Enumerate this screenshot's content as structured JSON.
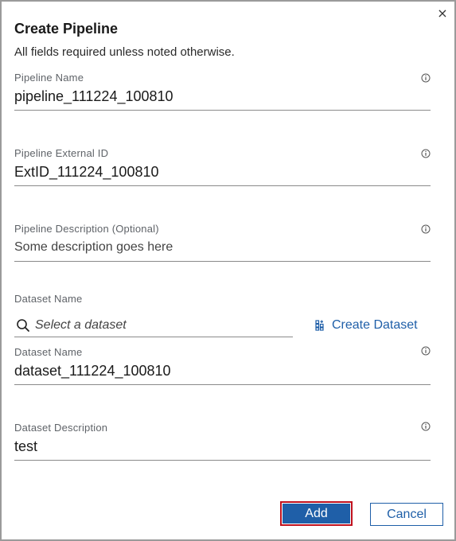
{
  "dialog": {
    "title": "Create Pipeline",
    "subtitle": "All fields required unless noted otherwise.",
    "close_glyph": "×"
  },
  "fields": {
    "pipeline_name": {
      "label": "Pipeline Name",
      "value": "pipeline_111224_100810"
    },
    "pipeline_external_id": {
      "label": "Pipeline External ID",
      "value": "ExtID_111224_100810"
    },
    "pipeline_description": {
      "label": "Pipeline Description (Optional)",
      "value": "Some description goes here"
    },
    "dataset_section_label": "Dataset Name",
    "dataset_search": {
      "placeholder": "Select a dataset"
    },
    "create_dataset_label": "Create Dataset",
    "dataset_name": {
      "label": "Dataset Name",
      "value": "dataset_111224_100810"
    },
    "dataset_description": {
      "label": "Dataset Description",
      "value": "test"
    }
  },
  "buttons": {
    "add": "Add",
    "cancel": "Cancel"
  },
  "colors": {
    "primary": "#1f5fa8",
    "highlight_border": "#c0121e",
    "label": "#5f6368"
  },
  "icons": {
    "close": "close-icon",
    "info": "info-icon",
    "search": "search-icon",
    "create_dataset": "dataset-icon"
  }
}
